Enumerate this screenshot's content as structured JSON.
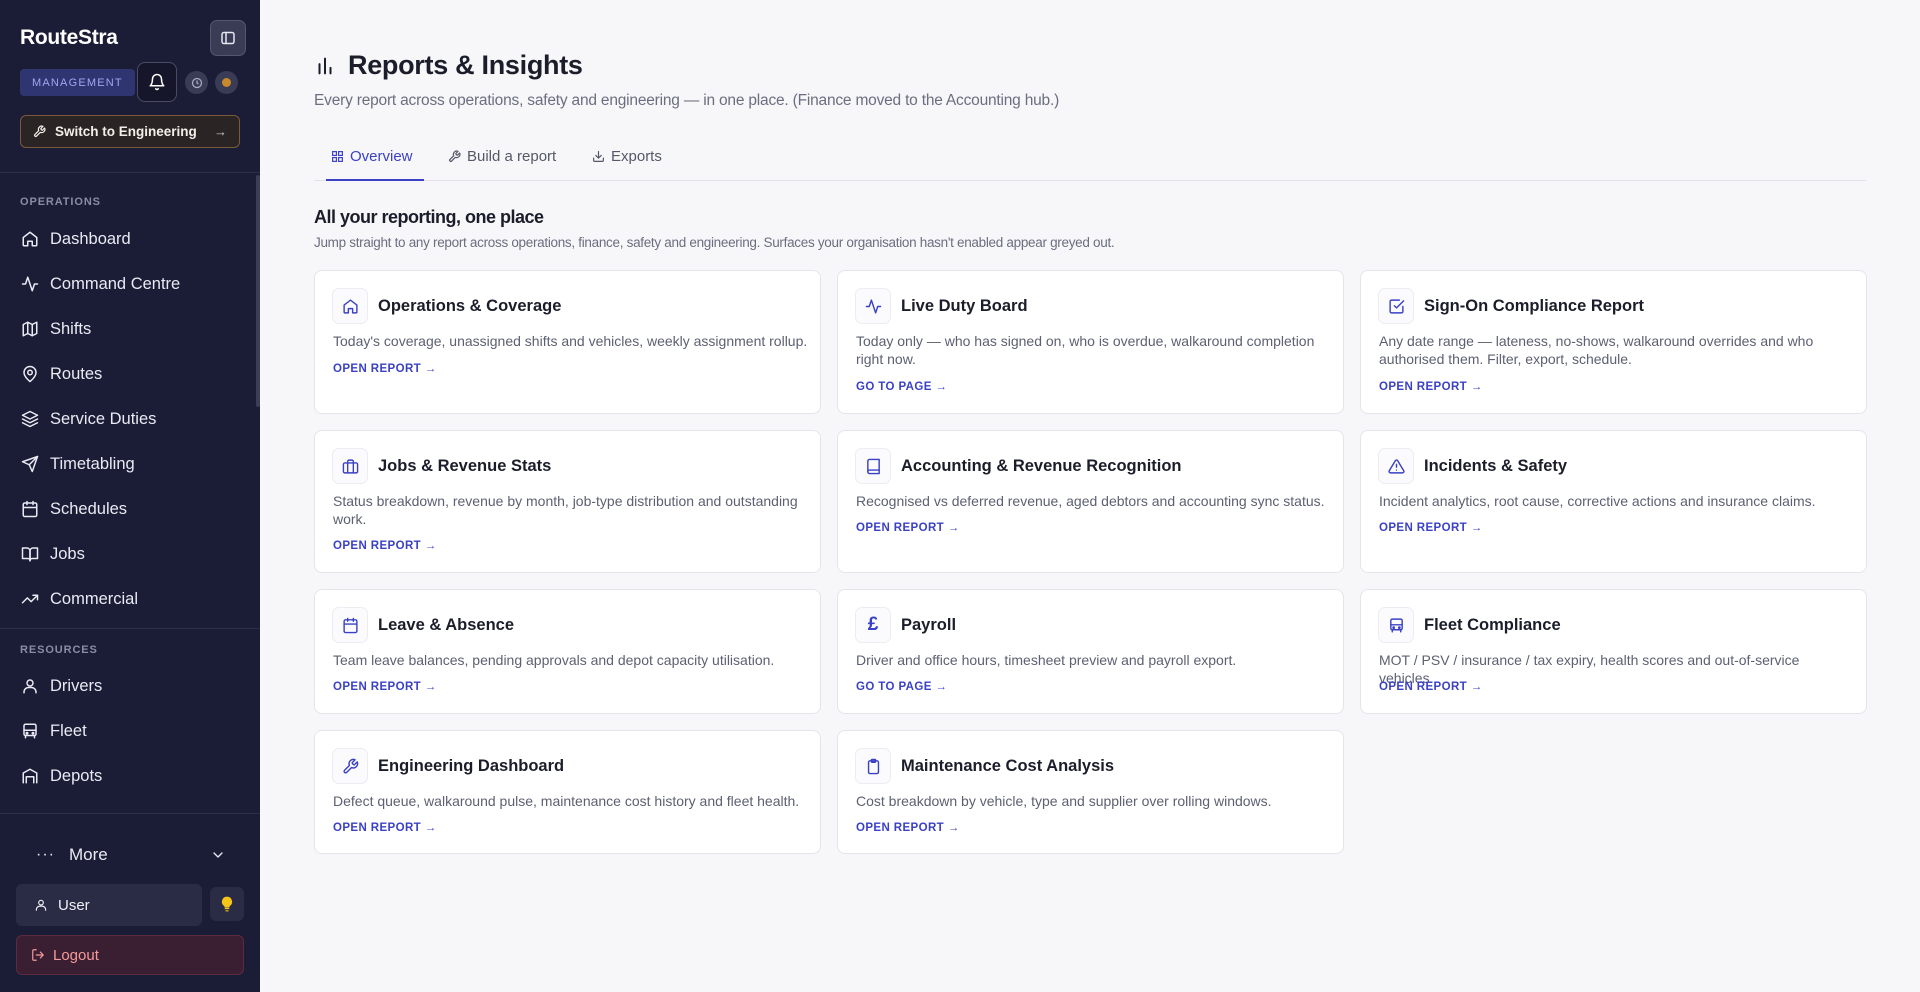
{
  "app": {
    "name": "RouteStra",
    "role_badge": "MANAGEMENT",
    "switch_label": "Switch to Engineering"
  },
  "sidebar": {
    "sections": [
      {
        "label": "OPERATIONS"
      },
      {
        "label": "RESOURCES"
      }
    ],
    "operations_items": [
      {
        "label": "Dashboard",
        "icon": "dashboard-icon"
      },
      {
        "label": "Command Centre",
        "icon": "activity-icon"
      },
      {
        "label": "Shifts",
        "icon": "map-icon"
      },
      {
        "label": "Routes",
        "icon": "map-pin-icon"
      },
      {
        "label": "Service Duties",
        "icon": "layers-icon"
      },
      {
        "label": "Timetabling",
        "icon": "send-icon"
      },
      {
        "label": "Schedules",
        "icon": "calendar-icon"
      },
      {
        "label": "Jobs",
        "icon": "book-icon"
      },
      {
        "label": "Commercial",
        "icon": "trending-up-icon"
      }
    ],
    "resources_items": [
      {
        "label": "Drivers",
        "icon": "user-icon"
      },
      {
        "label": "Fleet",
        "icon": "bus-icon"
      },
      {
        "label": "Depots",
        "icon": "building-icon"
      }
    ],
    "more_label": "More",
    "user_label": "User",
    "logout_label": "Logout"
  },
  "page": {
    "title": "Reports & Insights",
    "subtitle": "Every report across operations, safety and engineering — in one place. (Finance moved to the Accounting hub.)",
    "tabs": [
      {
        "label": "Overview",
        "icon": "grid-icon",
        "active": true
      },
      {
        "label": "Build a report",
        "icon": "wrench-icon",
        "active": false
      },
      {
        "label": "Exports",
        "icon": "download-icon",
        "active": false
      }
    ],
    "section_title": "All your reporting, one place",
    "section_desc": "Jump straight to any report across operations, finance, safety and engineering. Surfaces your organisation hasn't enabled appear greyed out."
  },
  "cards": [
    {
      "title": "Operations & Coverage",
      "icon": "home-icon",
      "desc": "Today's coverage, unassigned shifts and vehicles, weekly assignment rollup.",
      "link": "OPEN REPORT →"
    },
    {
      "title": "Live Duty Board",
      "icon": "activity-icon",
      "desc": "Today only — who has signed on, who is overdue, walkaround completion right now.",
      "link": "GO TO PAGE →"
    },
    {
      "title": "Sign-On Compliance Report",
      "icon": "check-square-icon",
      "desc": "Any date range — lateness, no-shows, walkaround overrides and who authorised them. Filter, export, schedule.",
      "link": "OPEN REPORT →"
    },
    {
      "title": "Jobs & Revenue Stats",
      "icon": "briefcase-icon",
      "desc": "Status breakdown, revenue by month, job-type distribution and outstanding work.",
      "link": "OPEN REPORT →"
    },
    {
      "title": "Accounting & Revenue Recognition",
      "icon": "book-icon",
      "desc": "Recognised vs deferred revenue, aged debtors and accounting sync status.",
      "link": "OPEN REPORT →"
    },
    {
      "title": "Incidents & Safety",
      "icon": "alert-triangle-icon",
      "desc": "Incident analytics, root cause, corrective actions and insurance claims.",
      "link": "OPEN REPORT →"
    },
    {
      "title": "Leave & Absence",
      "icon": "calendar-icon",
      "desc": "Team leave balances, pending approvals and depot capacity utilisation.",
      "link": "OPEN REPORT →"
    },
    {
      "title": "Payroll",
      "icon": "pound-icon",
      "desc": "Driver and office hours, timesheet preview and payroll export.",
      "link": "GO TO PAGE →"
    },
    {
      "title": "Fleet Compliance",
      "icon": "bus-icon",
      "desc": "MOT / PSV / insurance / tax expiry, health scores and out-of-service vehicles.",
      "link": "OPEN REPORT →"
    },
    {
      "title": "Engineering Dashboard",
      "icon": "wrench-icon",
      "desc": "Defect queue, walkaround pulse, maintenance cost history and fleet health.",
      "link": "OPEN REPORT →"
    },
    {
      "title": "Maintenance Cost Analysis",
      "icon": "clipboard-icon",
      "desc": "Cost breakdown by vehicle, type and supplier over rolling windows.",
      "link": "OPEN REPORT →"
    }
  ],
  "colors": {
    "sidebar_bg": "#1b1c35",
    "accent": "#3b41c5",
    "page_bg": "#f7f7f9"
  }
}
